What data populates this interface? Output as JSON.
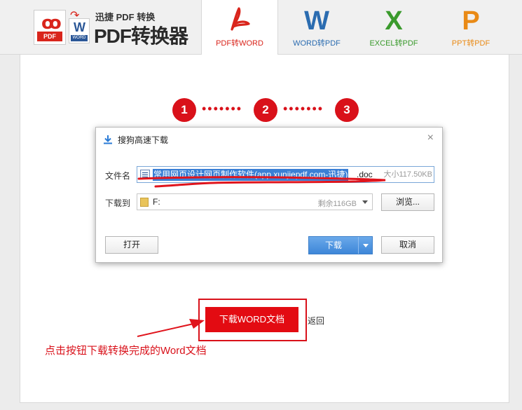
{
  "header": {
    "logo_small": "迅捷 PDF 转换",
    "logo_big": "PDF转换器",
    "logo_pdf_badge": "PDF",
    "logo_word_badge": "WORD",
    "tabs": [
      {
        "glyph": "",
        "label": "PDF转WORD",
        "color": "#d9251c",
        "active": true
      },
      {
        "glyph": "W",
        "label": "WORD转PDF",
        "color": "#2b6cb0",
        "active": false
      },
      {
        "glyph": "X",
        "label": "EXCEL转PDF",
        "color": "#3a9a2c",
        "active": false
      },
      {
        "glyph": "P",
        "label": "PPT转PDF",
        "color": "#e98a16",
        "active": false
      }
    ]
  },
  "steps": [
    "1",
    "2",
    "3"
  ],
  "dialog": {
    "title": "搜狗高速下载",
    "filename_label": "文件名",
    "filename_selected": "常用网页设计网页制作软件(app.xunjiepdf.com-迅捷)",
    "filename_ext": ".doc",
    "file_size": "大小117.50KB",
    "dest_label": "下载到",
    "dest_value": "F:",
    "dest_free": "剩余116GB",
    "browse_label": "浏览...",
    "open_label": "打开",
    "download_label": "下载",
    "cancel_label": "取消"
  },
  "download_word_label": "下载WORD文档",
  "back_label": "返回",
  "hint": "点击按钮下载转换完成的Word文档",
  "colors": {
    "accent_red": "#d9111a",
    "primary_blue": "#3d86d8"
  }
}
